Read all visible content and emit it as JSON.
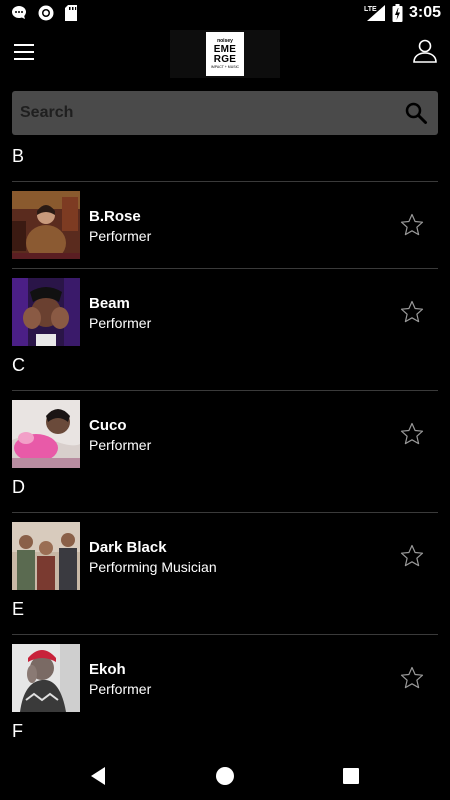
{
  "status_bar": {
    "time": "3:05",
    "network": "LTE",
    "icons": [
      "chat-bubble-icon",
      "circle-icon",
      "sd-card-icon",
      "lte-icon",
      "signal-icon",
      "battery-charging-icon"
    ]
  },
  "header": {
    "logo": {
      "brand": "noisey",
      "line1": "EME",
      "line2": "RGE",
      "tagline": "IMPACT + MUSIC"
    }
  },
  "search": {
    "placeholder": "Search"
  },
  "colors": {
    "background": "#000000",
    "search_bg": "#4a4a4a",
    "divider": "#3a3a3a",
    "text": "#ffffff"
  },
  "sections": [
    {
      "letter": "B",
      "items": [
        {
          "name": "B.Rose",
          "role": "Performer"
        },
        {
          "name": "Beam",
          "role": "Performer"
        }
      ]
    },
    {
      "letter": "C",
      "items": [
        {
          "name": "Cuco",
          "role": "Performer"
        }
      ]
    },
    {
      "letter": "D",
      "items": [
        {
          "name": "Dark Black",
          "role": "Performing Musician"
        }
      ]
    },
    {
      "letter": "E",
      "items": [
        {
          "name": "Ekoh",
          "role": "Performer"
        }
      ]
    },
    {
      "letter": "F",
      "items": []
    }
  ]
}
